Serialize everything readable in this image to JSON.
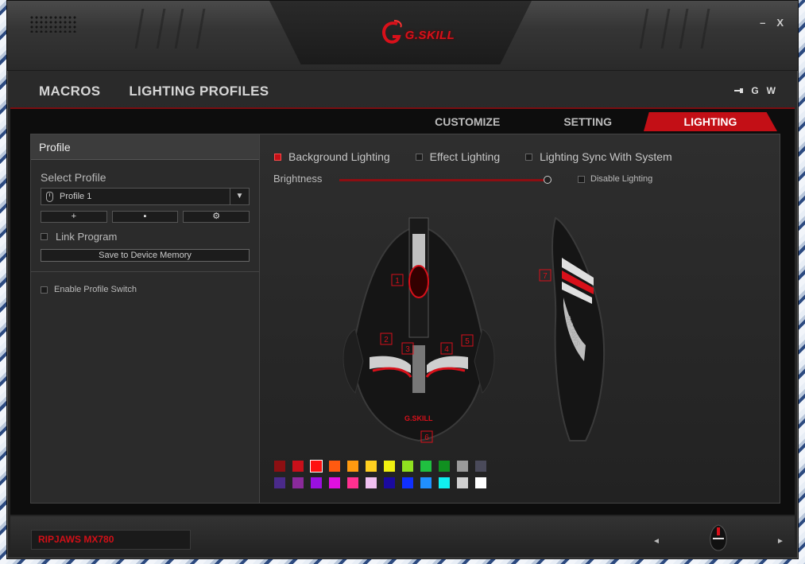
{
  "window": {
    "logo_text": "G.SKILL",
    "minimize_label": "–",
    "close_label": "X"
  },
  "nav": {
    "items": [
      "MACROS",
      "LIGHTING PROFILES"
    ],
    "right_g": "G",
    "right_w": "W",
    "usb_icon": "usb-icon"
  },
  "tabs": [
    "CUSTOMIZE",
    "SETTING",
    "LIGHTING"
  ],
  "active_tab": "LIGHTING",
  "profile_panel": {
    "header": "Profile",
    "select_label": "Select Profile",
    "selected_profile": "Profile 1",
    "add_button": "+",
    "delete_button": "▪",
    "settings_button": "⚙",
    "link_program_label": "Link Program",
    "save_button": "Save to Device Memory",
    "enable_switch_label": "Enable Profile Switch"
  },
  "lighting": {
    "modes": [
      {
        "label": "Background Lighting",
        "checked": true
      },
      {
        "label": "Effect Lighting",
        "checked": false
      },
      {
        "label": "Lighting Sync With System",
        "checked": false
      }
    ],
    "brightness_label": "Brightness",
    "brightness_value": 1.0,
    "disable_label": "Disable Lighting",
    "zones": [
      "1",
      "2",
      "3",
      "4",
      "5",
      "6",
      "7"
    ],
    "mouse_logo": "G.SKILL",
    "side_text": "RIPJAWS",
    "palette": [
      "#8c0f12",
      "#c8101a",
      "#ff1010",
      "#ff5a10",
      "#ff9a10",
      "#ffd020",
      "#f0f010",
      "#90e020",
      "#20c040",
      "#109020",
      "#9a9a9a",
      "#4a4a5a",
      "#4a2a8a",
      "#8a2a9a",
      "#9a10e0",
      "#e010e0",
      "#ff3090",
      "#f0c0f0",
      "#1a0aa0",
      "#1030ff",
      "#2090ff",
      "#10f0f0",
      "#d0d0d0",
      "#ffffff"
    ],
    "selected_color_index": 2
  },
  "footer": {
    "model": "RIPJAWS MX780",
    "prev": "◄",
    "next": "►"
  }
}
